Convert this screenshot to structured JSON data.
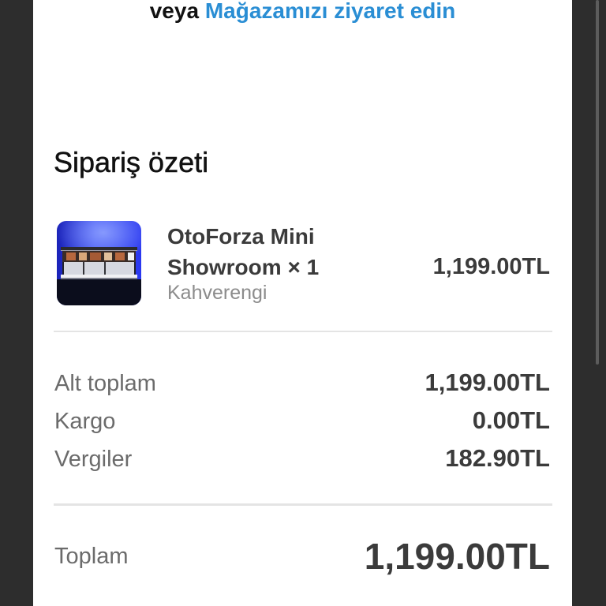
{
  "store_link": {
    "prefix": "veya",
    "label": "Mağazamızı ziyaret edin"
  },
  "order_summary": {
    "title": "Sipariş özeti",
    "item": {
      "name": "OtoForza Mini Showroom",
      "quantity": "× 1",
      "variant": "Kahverengi",
      "price": "1,199.00TL"
    },
    "lines": [
      {
        "label": "Alt toplam",
        "value": "1,199.00TL"
      },
      {
        "label": "Kargo",
        "value": "0.00TL"
      },
      {
        "label": "Vergiler",
        "value": "182.90TL"
      }
    ],
    "total": {
      "label": "Toplam",
      "value": "1,199.00TL"
    }
  },
  "colors": {
    "background": "#2d2d2d",
    "card": "#ffffff",
    "link": "#2a8ed4",
    "text_primary": "#111111",
    "text_value": "#3b3b3b",
    "text_muted": "#6b6b6b",
    "divider": "#e4e4e4"
  }
}
